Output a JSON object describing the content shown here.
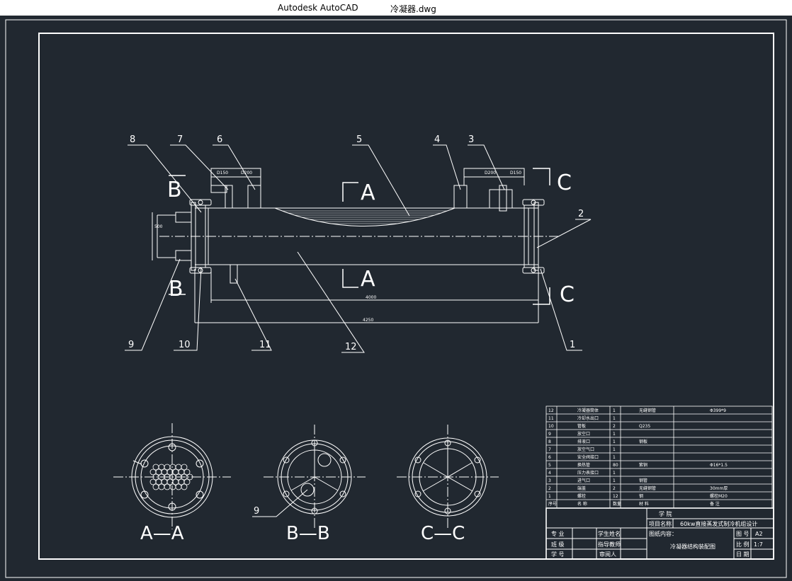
{
  "window": {
    "app_name": "Autodesk AutoCAD",
    "file_name": "冷凝器.dwg"
  },
  "drawing": {
    "balloons": [
      "1",
      "2",
      "3",
      "4",
      "5",
      "6",
      "7",
      "8",
      "9",
      "10",
      "11",
      "12"
    ],
    "section_markers": {
      "a": "A",
      "b": "B",
      "c": "C"
    },
    "section_titles": [
      "A—A",
      "B—B",
      "C—C"
    ],
    "section_b_callout": "9",
    "dimension_tags": [
      "D150",
      "D200",
      "D200",
      "D150",
      "4000",
      "4250",
      "500"
    ]
  },
  "bom": {
    "rows": [
      {
        "no": "12",
        "name": "冷凝器筒体",
        "qty": "1",
        "mat": "无缝钢管",
        "note": "Φ399*9"
      },
      {
        "no": "11",
        "name": "冷却水出口",
        "qty": "1",
        "mat": "",
        "note": ""
      },
      {
        "no": "10",
        "name": "管板",
        "qty": "2",
        "mat": "Q235",
        "note": ""
      },
      {
        "no": "9",
        "name": "放空口",
        "qty": "1",
        "mat": "",
        "note": ""
      },
      {
        "no": "8",
        "name": "排液口",
        "qty": "1",
        "mat": "钢板",
        "note": ""
      },
      {
        "no": "7",
        "name": "放空气口",
        "qty": "1",
        "mat": "",
        "note": ""
      },
      {
        "no": "6",
        "name": "安全阀接口",
        "qty": "1",
        "mat": "",
        "note": ""
      },
      {
        "no": "5",
        "name": "换热管",
        "qty": "80",
        "mat": "紫铜",
        "note": "Φ16*1.5"
      },
      {
        "no": "4",
        "name": "压力表接口",
        "qty": "1",
        "mat": "",
        "note": ""
      },
      {
        "no": "3",
        "name": "进气口",
        "qty": "1",
        "mat": "钢管",
        "note": ""
      },
      {
        "no": "2",
        "name": "端盖",
        "qty": "2",
        "mat": "无缝钢管",
        "note": "30mm厚"
      },
      {
        "no": "1",
        "name": "螺栓",
        "qty": "12",
        "mat": "钢",
        "note": "螺栓M20"
      }
    ],
    "header": {
      "no": "序号",
      "name": "名 称",
      "qty": "数量",
      "mat": "材 料",
      "note": "备 注"
    }
  },
  "title_block": {
    "school_label": "学 院",
    "project_label": "项目名称",
    "project_value": "60kw直接蒸发式制冷机组设计",
    "content_label": "图纸内容：",
    "drawing_title": "冷凝器结构装配图",
    "major_label": "专 业",
    "class_label": "班 级",
    "student_no_label": "学 号",
    "student_name_label": "学生姓名",
    "advisor_label": "指导教师",
    "reviewer_label": "审阅人",
    "drawing_no_label": "图 号",
    "drawing_no_value": "A2",
    "scale_label": "比 例",
    "scale_value": "1:7",
    "date_label": "日 期"
  }
}
